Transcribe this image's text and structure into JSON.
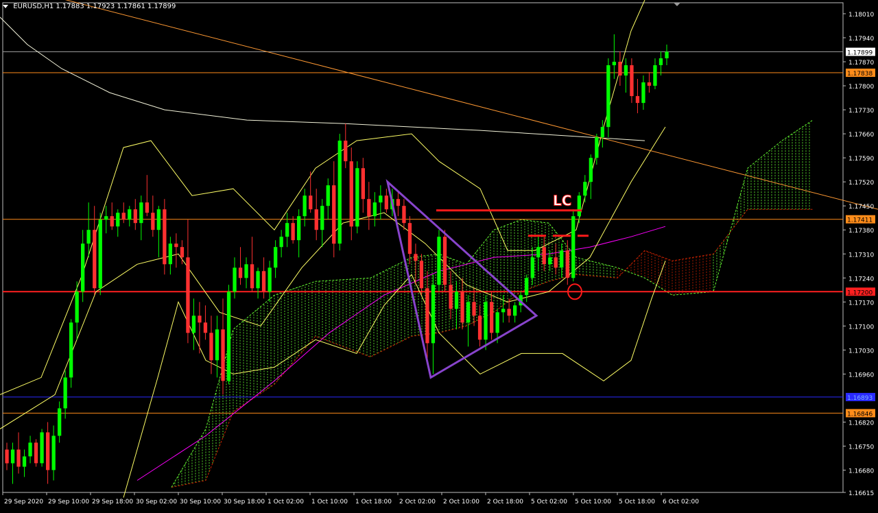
{
  "header": {
    "symbol": "EURUSD,H1",
    "ohlc": "1.17883 1.17923 1.17861 1.17899"
  },
  "annotations": {
    "lc_label": "LC"
  },
  "colors": {
    "background": "#000000",
    "bull": "#00ff00",
    "bear": "#ff3030",
    "grid_frame": "#c0c0c0",
    "ma200": "#f5f5dc",
    "ma_magenta": "#ff00ff",
    "bollinger": "#ffff66",
    "trendline": "#ff9933",
    "triangle": "#8844cc",
    "lc_line": "#ff1a1a",
    "cloud_bull": "#66ff33",
    "cloud_bear": "#cc2200",
    "hline_orange": "#ff8c1a",
    "hline_red": "#ff2020",
    "hline_blue": "#2a2aff"
  },
  "chart_data": {
    "type": "candlestick",
    "y_ticks": [
      "1.18010",
      "1.17940",
      "1.17870",
      "1.17800",
      "1.17730",
      "1.17660",
      "1.17590",
      "1.17520",
      "1.17450",
      "1.17380",
      "1.17310",
      "1.17240",
      "1.17170",
      "1.17100",
      "1.17030",
      "1.16960",
      "1.16820",
      "1.16750",
      "1.16680",
      "1.16615"
    ],
    "x_ticks": [
      "29 Sep 2020",
      "29 Sep 10:00",
      "29 Sep 18:00",
      "30 Sep 02:00",
      "30 Sep 10:00",
      "30 Sep 18:00",
      "1 Oct 02:00",
      "1 Oct 10:00",
      "1 Oct 18:00",
      "2 Oct 02:00",
      "2 Oct 10:00",
      "2 Oct 18:00",
      "5 Oct 02:00",
      "5 Oct 10:00",
      "5 Oct 18:00",
      "6 Oct 02:00"
    ],
    "price_tags": [
      {
        "label": "1.17899",
        "value": 1.17899,
        "style": "current"
      },
      {
        "label": "1.17838",
        "value": 1.17838,
        "style": "orange"
      },
      {
        "label": "1.17411",
        "value": 1.17411,
        "style": "orange"
      },
      {
        "label": "1.17200",
        "value": 1.172,
        "style": "red"
      },
      {
        "label": "1.16893",
        "value": 1.16893,
        "style": "blue"
      },
      {
        "label": "1.16846",
        "value": 1.16846,
        "style": "orange"
      }
    ],
    "candles": [
      [
        1.1674,
        1.1676,
        1.1668,
        1.167
      ],
      [
        1.167,
        1.1676,
        1.1664,
        1.1674
      ],
      [
        1.1674,
        1.1679,
        1.1667,
        1.1669
      ],
      [
        1.1669,
        1.1674,
        1.1666,
        1.1672
      ],
      [
        1.1672,
        1.1678,
        1.167,
        1.1676
      ],
      [
        1.1676,
        1.1677,
        1.1669,
        1.167
      ],
      [
        1.167,
        1.168,
        1.1669,
        1.1679
      ],
      [
        1.1679,
        1.1682,
        1.1664,
        1.1668
      ],
      [
        1.1668,
        1.1681,
        1.1665,
        1.1678
      ],
      [
        1.1678,
        1.1688,
        1.1676,
        1.1686
      ],
      [
        1.1686,
        1.1697,
        1.1683,
        1.1695
      ],
      [
        1.1695,
        1.1712,
        1.1692,
        1.1711
      ],
      [
        1.1711,
        1.1723,
        1.1706,
        1.172
      ],
      [
        1.172,
        1.1738,
        1.1717,
        1.1734
      ],
      [
        1.1734,
        1.1746,
        1.173,
        1.1738
      ],
      [
        1.1738,
        1.1745,
        1.1719,
        1.1721
      ],
      [
        1.1721,
        1.1743,
        1.1719,
        1.1741
      ],
      [
        1.1741,
        1.1745,
        1.1737,
        1.1742
      ],
      [
        1.1742,
        1.1746,
        1.1738,
        1.1739
      ],
      [
        1.1739,
        1.1744,
        1.1736,
        1.1743
      ],
      [
        1.1743,
        1.1746,
        1.174,
        1.1741
      ],
      [
        1.1741,
        1.1745,
        1.1739,
        1.1744
      ],
      [
        1.1744,
        1.1747,
        1.1738,
        1.174
      ],
      [
        1.174,
        1.1748,
        1.1735,
        1.1746
      ],
      [
        1.1746,
        1.1754,
        1.1742,
        1.1743
      ],
      [
        1.1743,
        1.1748,
        1.1736,
        1.1738
      ],
      [
        1.1738,
        1.1745,
        1.173,
        1.1744
      ],
      [
        1.1744,
        1.1747,
        1.1725,
        1.1728
      ],
      [
        1.1728,
        1.1736,
        1.1725,
        1.1734
      ],
      [
        1.1734,
        1.1737,
        1.1727,
        1.1733
      ],
      [
        1.1733,
        1.1735,
        1.1728,
        1.173
      ],
      [
        1.173,
        1.1741,
        1.1705,
        1.1708
      ],
      [
        1.1708,
        1.1718,
        1.1703,
        1.1713
      ],
      [
        1.1713,
        1.1717,
        1.1702,
        1.1711
      ],
      [
        1.1711,
        1.1716,
        1.1706,
        1.1708
      ],
      [
        1.1708,
        1.1713,
        1.1696,
        1.17
      ],
      [
        1.17,
        1.1713,
        1.1695,
        1.1709
      ],
      [
        1.1709,
        1.1718,
        1.169,
        1.1694
      ],
      [
        1.1694,
        1.1722,
        1.1693,
        1.172
      ],
      [
        1.172,
        1.173,
        1.1718,
        1.1727
      ],
      [
        1.1727,
        1.1733,
        1.1722,
        1.1724
      ],
      [
        1.1724,
        1.173,
        1.1721,
        1.1728
      ],
      [
        1.1728,
        1.1736,
        1.172,
        1.1721
      ],
      [
        1.1721,
        1.1727,
        1.1718,
        1.1726
      ],
      [
        1.1726,
        1.173,
        1.1718,
        1.172
      ],
      [
        1.172,
        1.1729,
        1.1717,
        1.1727
      ],
      [
        1.1727,
        1.1735,
        1.1724,
        1.1733
      ],
      [
        1.1733,
        1.1738,
        1.173,
        1.1736
      ],
      [
        1.1736,
        1.1743,
        1.1733,
        1.174
      ],
      [
        1.174,
        1.1742,
        1.1734,
        1.1735
      ],
      [
        1.1735,
        1.1744,
        1.173,
        1.1742
      ],
      [
        1.1742,
        1.175,
        1.1739,
        1.1748
      ],
      [
        1.1748,
        1.1755,
        1.1743,
        1.1744
      ],
      [
        1.1744,
        1.175,
        1.1735,
        1.1738
      ],
      [
        1.1738,
        1.1747,
        1.1733,
        1.1745
      ],
      [
        1.1745,
        1.1753,
        1.1741,
        1.1751
      ],
      [
        1.1751,
        1.1758,
        1.173,
        1.1734
      ],
      [
        1.1734,
        1.1766,
        1.1732,
        1.1764
      ],
      [
        1.1764,
        1.1769,
        1.1756,
        1.1758
      ],
      [
        1.1758,
        1.1762,
        1.1735,
        1.1739
      ],
      [
        1.1739,
        1.1758,
        1.1737,
        1.1756
      ],
      [
        1.1756,
        1.1759,
        1.1743,
        1.1747
      ],
      [
        1.1747,
        1.1752,
        1.1738,
        1.1742
      ],
      [
        1.1742,
        1.1749,
        1.1739,
        1.1746
      ],
      [
        1.1746,
        1.1751,
        1.1741,
        1.1748
      ],
      [
        1.1748,
        1.175,
        1.1743,
        1.1744
      ],
      [
        1.1744,
        1.175,
        1.1742,
        1.1747
      ],
      [
        1.1747,
        1.1749,
        1.1742,
        1.1745
      ],
      [
        1.1745,
        1.1747,
        1.1738,
        1.174
      ],
      [
        1.174,
        1.1742,
        1.1728,
        1.1731
      ],
      [
        1.1731,
        1.1734,
        1.1722,
        1.1729
      ],
      [
        1.1729,
        1.1731,
        1.1719,
        1.1721
      ],
      [
        1.1721,
        1.1726,
        1.17,
        1.1705
      ],
      [
        1.1705,
        1.1725,
        1.1696,
        1.1722
      ],
      [
        1.1722,
        1.1738,
        1.172,
        1.1736
      ],
      [
        1.1736,
        1.1738,
        1.172,
        1.1722
      ],
      [
        1.1722,
        1.1726,
        1.1712,
        1.1715
      ],
      [
        1.1715,
        1.1723,
        1.1709,
        1.172
      ],
      [
        1.172,
        1.1724,
        1.1709,
        1.1711
      ],
      [
        1.1711,
        1.1719,
        1.1704,
        1.1717
      ],
      [
        1.1717,
        1.1721,
        1.171,
        1.1713
      ],
      [
        1.1713,
        1.1716,
        1.1704,
        1.1706
      ],
      [
        1.1706,
        1.1719,
        1.1703,
        1.1717
      ],
      [
        1.1717,
        1.172,
        1.1706,
        1.1708
      ],
      [
        1.1708,
        1.1715,
        1.1705,
        1.1714
      ],
      [
        1.1714,
        1.1719,
        1.1711,
        1.1715
      ],
      [
        1.1715,
        1.1718,
        1.1711,
        1.1713
      ],
      [
        1.1713,
        1.1717,
        1.1711,
        1.1716
      ],
      [
        1.1716,
        1.172,
        1.1714,
        1.1719
      ],
      [
        1.1719,
        1.1725,
        1.1717,
        1.1724
      ],
      [
        1.1724,
        1.1733,
        1.1722,
        1.173
      ],
      [
        1.173,
        1.1736,
        1.1726,
        1.1733
      ],
      [
        1.1733,
        1.1736,
        1.1726,
        1.1728
      ],
      [
        1.1728,
        1.1732,
        1.1726,
        1.173
      ],
      [
        1.173,
        1.1734,
        1.1725,
        1.1727
      ],
      [
        1.1727,
        1.1734,
        1.1724,
        1.1732
      ],
      [
        1.1732,
        1.1735,
        1.1722,
        1.1724
      ],
      [
        1.1724,
        1.1744,
        1.1723,
        1.1742
      ],
      [
        1.1742,
        1.1749,
        1.174,
        1.1748
      ],
      [
        1.1748,
        1.1754,
        1.1746,
        1.1752
      ],
      [
        1.1752,
        1.176,
        1.1747,
        1.1759
      ],
      [
        1.1759,
        1.1766,
        1.1757,
        1.1765
      ],
      [
        1.1765,
        1.177,
        1.1762,
        1.1768
      ],
      [
        1.1768,
        1.1788,
        1.1765,
        1.1786
      ],
      [
        1.1786,
        1.1795,
        1.1782,
        1.1787
      ],
      [
        1.1787,
        1.179,
        1.178,
        1.1783
      ],
      [
        1.1783,
        1.1788,
        1.1778,
        1.1786
      ],
      [
        1.1786,
        1.1788,
        1.1775,
        1.1777
      ],
      [
        1.1777,
        1.1782,
        1.1772,
        1.1775
      ],
      [
        1.1775,
        1.1783,
        1.1773,
        1.1781
      ],
      [
        1.1781,
        1.1784,
        1.1778,
        1.178
      ],
      [
        1.178,
        1.1788,
        1.1779,
        1.1786
      ],
      [
        1.1786,
        1.179,
        1.1783,
        1.1788
      ],
      [
        1.1788,
        1.1792,
        1.1786,
        1.17899
      ]
    ],
    "overlays": {
      "ma200_white": [
        [
          0,
          1.18
        ],
        [
          40,
          1.1792
        ],
        [
          90,
          1.1785
        ],
        [
          160,
          1.1778
        ],
        [
          240,
          1.1773
        ],
        [
          360,
          1.177
        ],
        [
          500,
          1.1769
        ],
        [
          700,
          1.1767
        ],
        [
          860,
          1.1765
        ],
        [
          940,
          1.1764
        ]
      ],
      "ma_magenta": [
        [
          200,
          1.1665
        ],
        [
          300,
          1.1678
        ],
        [
          400,
          1.1694
        ],
        [
          480,
          1.1708
        ],
        [
          560,
          1.1719
        ],
        [
          640,
          1.1726
        ],
        [
          720,
          1.173
        ],
        [
          800,
          1.1731
        ],
        [
          860,
          1.1733
        ],
        [
          920,
          1.1736
        ],
        [
          970,
          1.1739
        ]
      ],
      "bb_upper": [
        [
          0,
          1.169
        ],
        [
          60,
          1.1695
        ],
        [
          120,
          1.1725
        ],
        [
          180,
          1.1762
        ],
        [
          220,
          1.1764
        ],
        [
          280,
          1.1748
        ],
        [
          340,
          1.175
        ],
        [
          400,
          1.1738
        ],
        [
          460,
          1.1756
        ],
        [
          520,
          1.1764
        ],
        [
          600,
          1.1766
        ],
        [
          640,
          1.1758
        ],
        [
          700,
          1.175
        ],
        [
          740,
          1.1732
        ],
        [
          780,
          1.1732
        ],
        [
          840,
          1.1738
        ],
        [
          880,
          1.1768
        ],
        [
          920,
          1.1796
        ],
        [
          940,
          1.1805
        ]
      ],
      "bb_middle": [
        [
          0,
          1.168
        ],
        [
          80,
          1.169
        ],
        [
          140,
          1.172
        ],
        [
          200,
          1.1728
        ],
        [
          260,
          1.1731
        ],
        [
          320,
          1.1714
        ],
        [
          380,
          1.171
        ],
        [
          440,
          1.1727
        ],
        [
          500,
          1.174
        ],
        [
          560,
          1.1743
        ],
        [
          620,
          1.1734
        ],
        [
          680,
          1.1722
        ],
        [
          740,
          1.1717
        ],
        [
          800,
          1.172
        ],
        [
          860,
          1.173
        ],
        [
          920,
          1.1752
        ],
        [
          970,
          1.1768
        ]
      ],
      "bb_lower": [
        [
          180,
          1.166
        ],
        [
          230,
          1.1695
        ],
        [
          260,
          1.1717
        ],
        [
          300,
          1.17
        ],
        [
          340,
          1.1696
        ],
        [
          400,
          1.1698
        ],
        [
          460,
          1.1706
        ],
        [
          520,
          1.1702
        ],
        [
          560,
          1.1716
        ],
        [
          600,
          1.1725
        ],
        [
          640,
          1.1708
        ],
        [
          700,
          1.1696
        ],
        [
          760,
          1.1702
        ],
        [
          820,
          1.1702
        ],
        [
          880,
          1.1694
        ],
        [
          920,
          1.17
        ],
        [
          950,
          1.1718
        ],
        [
          970,
          1.1729
        ]
      ],
      "cloud": [
        [
          250,
          1.1663,
          1.1663
        ],
        [
          300,
          1.1665,
          1.168
        ],
        [
          340,
          1.1685,
          1.1709
        ],
        [
          400,
          1.1693,
          1.1719
        ],
        [
          460,
          1.1707,
          1.1723
        ],
        [
          540,
          1.1701,
          1.1724
        ],
        [
          600,
          1.1707,
          1.173
        ],
        [
          640,
          1.1708,
          1.1731
        ],
        [
          680,
          1.171,
          1.1728
        ],
        [
          720,
          1.1714,
          1.1738
        ],
        [
          760,
          1.172,
          1.1741
        ],
        [
          800,
          1.1723,
          1.174
        ],
        [
          840,
          1.1725,
          1.173
        ],
        [
          900,
          1.1724,
          1.1727
        ],
        [
          940,
          1.1732,
          1.1724
        ],
        [
          980,
          1.1729,
          1.1719
        ],
        [
          1040,
          1.1731,
          1.172
        ],
        [
          1090,
          1.1744,
          1.1756
        ],
        [
          1140,
          1.1744,
          1.1764
        ],
        [
          1185,
          1.1744,
          1.177
        ]
      ],
      "trendline": [
        [
          0,
          1.181
        ],
        [
          1280,
          1.1744
        ]
      ],
      "triangle": [
        [
          565,
          1.1752
        ],
        [
          782,
          1.1713
        ],
        [
          628,
          1.1695
        ]
      ],
      "lc_level": 1.17437,
      "lc_line_x": [
        636,
        848
      ],
      "lc_dash": [
        [
          770,
          1.17363
        ],
        [
          858,
          1.17363
        ]
      ],
      "circle_center": [
        [
          838,
          1.172
        ]
      ]
    }
  }
}
